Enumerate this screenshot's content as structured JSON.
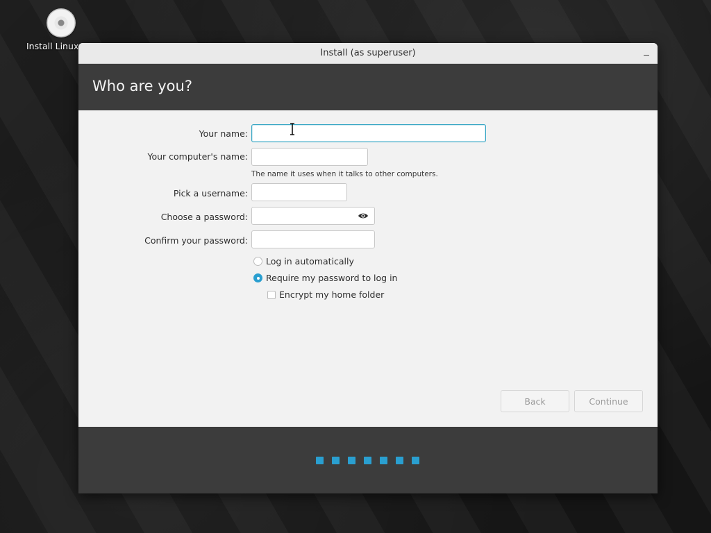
{
  "desktop": {
    "icon_label": "Install Linux M"
  },
  "window": {
    "title": "Install (as superuser)"
  },
  "header": {
    "title": "Who are you?"
  },
  "form": {
    "your_name_label": "Your name:",
    "your_name_value": "",
    "computer_name_label": "Your computer's name:",
    "computer_name_value": "",
    "computer_name_hint": "The name it uses when it talks to other computers.",
    "username_label": "Pick a username:",
    "username_value": "",
    "password_label": "Choose a password:",
    "password_value": "",
    "confirm_password_label": "Confirm your password:",
    "confirm_password_value": "",
    "login_auto_label": "Log in automatically",
    "login_auto_selected": false,
    "require_password_label": "Require my password to log in",
    "require_password_selected": true,
    "encrypt_home_label": "Encrypt my home folder",
    "encrypt_home_checked": false
  },
  "buttons": {
    "back_label": "Back",
    "continue_label": "Continue"
  },
  "progress": {
    "steps": 7
  },
  "colors": {
    "accent": "#2a9fd0",
    "header_bg": "#3c3c3c",
    "window_bg": "#f2f2f2",
    "focus_border": "#35a5c4"
  },
  "icons": {
    "desktop_icon": "disc-icon",
    "reveal_password": "eye-icon",
    "text_cursor": "i-beam-cursor-icon"
  }
}
